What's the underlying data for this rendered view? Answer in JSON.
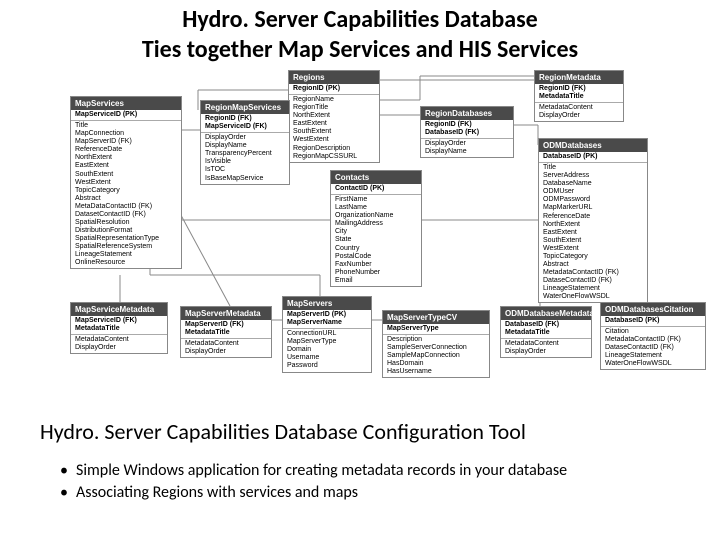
{
  "title_line1": "Hydro. Server Capabilities Database",
  "title_line2": "Ties together Map Services and HIS Services",
  "caption": "Hydro. Server Capabilities Database Configuration Tool",
  "bullets": [
    "Simple Windows application for creating metadata records in your database",
    "Associating Regions with services and maps"
  ],
  "tables": {
    "regions": {
      "name": "Regions",
      "pk": [
        "RegionID (PK)"
      ],
      "fields": [
        "RegionName",
        "RegionTitle",
        "NorthExtent",
        "EastExtent",
        "SouthExtent",
        "WestExtent",
        "RegionDescription",
        "RegionMapCSSURL"
      ]
    },
    "regionmetadata": {
      "name": "RegionMetadata",
      "pk": [
        "RegionID (FK)",
        "MetadataTitle"
      ],
      "fields": [
        "MetadataContent",
        "DisplayOrder"
      ]
    },
    "mapservices": {
      "name": "MapServices",
      "pk": [
        "MapServiceID (PK)"
      ],
      "fields": [
        "Title",
        "MapConnection",
        "MapServerID (FK)",
        "ReferenceDate",
        "NorthExtent",
        "EastExtent",
        "SouthExtent",
        "WestExtent",
        "TopicCategory",
        "Abstract",
        "MetaDataContactID (FK)",
        "DatasetContactID (FK)",
        "SpatialResolution",
        "DistributionFormat",
        "SpatialRepresentationType",
        "SpatialReferenceSystem",
        "LineageStatement",
        "OnlineResource"
      ]
    },
    "regionmapservices": {
      "name": "RegionMapServices",
      "pk": [
        "RegionID (FK)",
        "MapServiceID (FK)"
      ],
      "fields": [
        "DisplayOrder",
        "DisplayName",
        "TransparencyPercent",
        "IsVisible",
        "IsTOC",
        "IsBaseMapService"
      ]
    },
    "regiondatabases": {
      "name": "RegionDatabases",
      "pk": [
        "RegionID (FK)",
        "DatabaseID (FK)"
      ],
      "fields": [
        "DisplayOrder",
        "DisplayName"
      ]
    },
    "odmdatabases": {
      "name": "ODMDatabases",
      "pk": [
        "DatabaseID (PK)"
      ],
      "fields": [
        "Title",
        "ServerAddress",
        "DatabaseName",
        "ODMUser",
        "ODMPassword",
        "MapMarkerURL",
        "ReferenceDate",
        "NorthExtent",
        "EastExtent",
        "SouthExtent",
        "WestExtent",
        "TopicCategory",
        "Abstract",
        "MetadataContactID (FK)",
        "DataseContactID (FK)",
        "LineageStatement",
        "WaterOneFlowWSDL"
      ]
    },
    "contacts": {
      "name": "Contacts",
      "pk": [
        "ContactID (PK)"
      ],
      "fields": [
        "FirstName",
        "LastName",
        "OrganizationName",
        "MailingAddress",
        "City",
        "State",
        "Country",
        "PostalCode",
        "FaxNumber",
        "PhoneNumber",
        "Email"
      ]
    },
    "mapservicemetadata": {
      "name": "MapServiceMetadata",
      "pk": [
        "MapServiceID (FK)",
        "MetadataTitle"
      ],
      "fields": [
        "MetadataContent",
        "DisplayOrder"
      ]
    },
    "mapservermetadata": {
      "name": "MapServerMetadata",
      "pk": [
        "MapServerID (FK)",
        "MetadataTitle"
      ],
      "fields": [
        "MetadataContent",
        "DisplayOrder"
      ]
    },
    "mapservers": {
      "name": "MapServers",
      "pk": [
        "MapServerID (PK)",
        "MapServerName"
      ],
      "fields": [
        "ConnectionURL",
        "MapServerType",
        "Domain",
        "Username",
        "Password"
      ]
    },
    "mapservertypecv": {
      "name": "MapServerTypeCV",
      "pk": [
        "MapServerType"
      ],
      "fields": [
        "Description",
        "SampleServerConnection",
        "SampleMapConnection",
        "HasDomain",
        "HasUsername"
      ]
    },
    "odmdatabasemetadata": {
      "name": "ODMDatabaseMetadata",
      "pk": [
        "DatabaseID (FK)",
        "MetadataTitle"
      ],
      "fields": [
        "MetadataContent",
        "DisplayOrder"
      ]
    },
    "odmdatabases2": {
      "name": "ODMDatabasesCitation",
      "pk": [
        "DatabaseID (PK)"
      ],
      "fields": [
        "Citation",
        "MetadataContactID (FK)",
        "DataseContactID (FK)",
        "LineageStatement",
        "WaterOneFlowWSDL"
      ]
    }
  }
}
